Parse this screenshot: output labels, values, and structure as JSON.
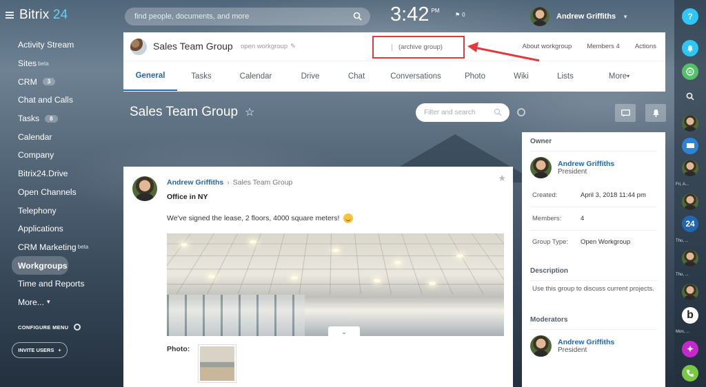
{
  "sidebar": {
    "logo": {
      "brand": "Bitrix",
      "num": "24"
    },
    "items": [
      {
        "label": "Activity Stream"
      },
      {
        "label": "Sites",
        "sup": "beta"
      },
      {
        "label": "CRM",
        "count": "3"
      },
      {
        "label": "Chat and Calls"
      },
      {
        "label": "Tasks",
        "count": "8"
      },
      {
        "label": "Calendar"
      },
      {
        "label": "Company"
      },
      {
        "label": "Bitrix24.Drive"
      },
      {
        "label": "Open Channels"
      },
      {
        "label": "Telephony"
      },
      {
        "label": "Applications"
      },
      {
        "label": "CRM Marketing",
        "sup": "beta"
      },
      {
        "label": "Workgroups",
        "active": true
      },
      {
        "label": "Time and Reports"
      },
      {
        "label": "More..."
      }
    ],
    "configure_label": "CONFIGURE MENU",
    "invite_label": "INVITE USERS"
  },
  "topbar": {
    "search_placeholder": "find people, documents, and more",
    "clock": "3:42",
    "ampm": "PM",
    "flag_count": "0",
    "user_name": "Andrew Griffiths"
  },
  "group_header": {
    "title": "Sales Team Group",
    "subtitle": "open workgroup",
    "archive_label": "(archive group)",
    "links": [
      "About workgroup",
      "Members 4",
      "Actions"
    ],
    "tabs": [
      "General",
      "Tasks",
      "Calendar",
      "Drive",
      "Chat",
      "Conversations",
      "Photo",
      "Wiki",
      "Lists",
      "More"
    ]
  },
  "page": {
    "title": "Sales Team Group",
    "filter_placeholder": "Filter and search"
  },
  "post": {
    "author": "Andrew Griffiths",
    "group": "Sales Team Group",
    "title": "Office in NY",
    "text": "We've signed the lease, 2 floors, 4000 square meters!",
    "photo_label": "Photo:"
  },
  "info": {
    "owner_heading": "Owner",
    "owner_name": "Andrew Griffiths",
    "owner_role": "President",
    "created_label": "Created:",
    "created_value": "April 3, 2018 11:44 pm",
    "members_label": "Members:",
    "members_value": "4",
    "type_label": "Group Type:",
    "type_value": "Open Workgroup",
    "description_heading": "Description",
    "description_text": "Use this group to discuss current projects.",
    "moderators_heading": "Moderators",
    "moderator_name": "Andrew Griffiths",
    "moderator_role": "President"
  },
  "rightbar": {
    "help": "?",
    "labels": [
      "Fri, A...",
      "Thu, ...",
      "Thu, ...",
      "Mon, ..."
    ],
    "badge_24": "24"
  },
  "colors": {
    "accent_blue": "#2067b0",
    "archive_red": "#e0393e",
    "bell_blue": "#2fc6f6",
    "chat_green": "#54c06a",
    "phone_green": "#7ac943"
  }
}
